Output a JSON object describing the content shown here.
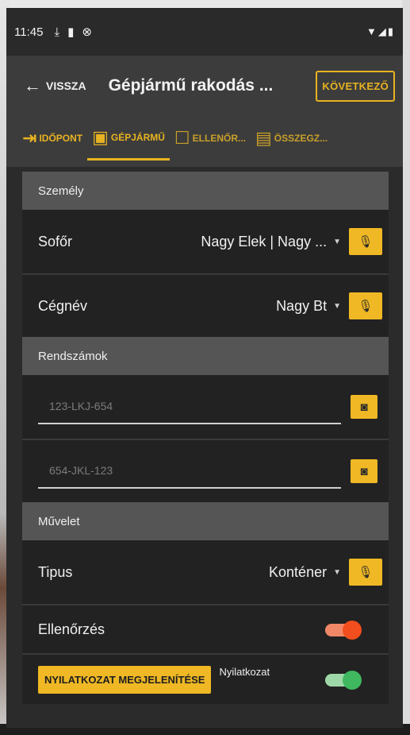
{
  "status": {
    "time": "11:45",
    "icons": [
      "download-done-icon",
      "sd-card-icon",
      "sync-icon"
    ],
    "right_icons": "wifi-signal-battery"
  },
  "appbar": {
    "back_label": "VISSZA",
    "title": "Gépjármű rakodás ...",
    "next_label": "KÖVETKEZŐ"
  },
  "tabs": [
    {
      "label": "IDŐPONT",
      "icon": "login-icon"
    },
    {
      "label": "GÉPJÁRMŰ",
      "icon": "bus-icon"
    },
    {
      "label": "ELLENŐR...",
      "icon": "clipboard-icon"
    },
    {
      "label": "ÖSSZEGZ...",
      "icon": "summary-icon"
    }
  ],
  "sections": {
    "person": {
      "title": "Személy",
      "driver_label": "Sofőr",
      "driver_value": "Nagy Elek | Nagy ...",
      "company_label": "Cégnév",
      "company_value": "Nagy Bt"
    },
    "plates": {
      "title": "Rendszámok",
      "plate1_placeholder": "123-LKJ-654",
      "plate2_placeholder": "654-JKL-123"
    },
    "operation": {
      "title": "Művelet",
      "type_label": "Tipus",
      "type_value": "Konténer",
      "check_label": "Ellenőrzés",
      "declaration_button": "NYILATKOZAT MEGJELENÍTÉSE",
      "declaration_label": "Nyilatkozat"
    }
  },
  "colors": {
    "accent": "#efb824",
    "toggle_on_orange": "#f24e1e",
    "toggle_on_green": "#3fb860"
  }
}
